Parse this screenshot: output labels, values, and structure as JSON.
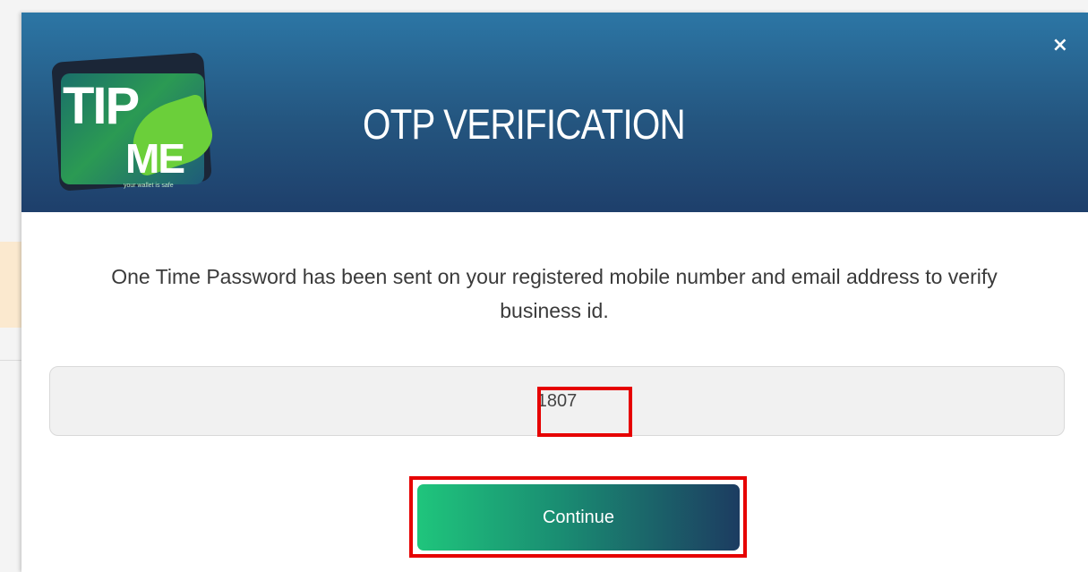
{
  "modal": {
    "title": "OTP VERIFICATION",
    "close_symbol": "×",
    "logo": {
      "line1": "TIP",
      "line2": "ME",
      "tagline": "your wallet is safe"
    },
    "message": "One Time Password has been sent on your registered mobile number and email address to verify business id.",
    "otp_value": "1807",
    "continue_label": "Continue"
  },
  "colors": {
    "header_top": "#2c76a5",
    "header_bottom": "#1e3f6b",
    "button_start": "#1fc57c",
    "button_end": "#1c3c61",
    "highlight": "#e60000"
  },
  "icons": {
    "close": "close-icon"
  }
}
